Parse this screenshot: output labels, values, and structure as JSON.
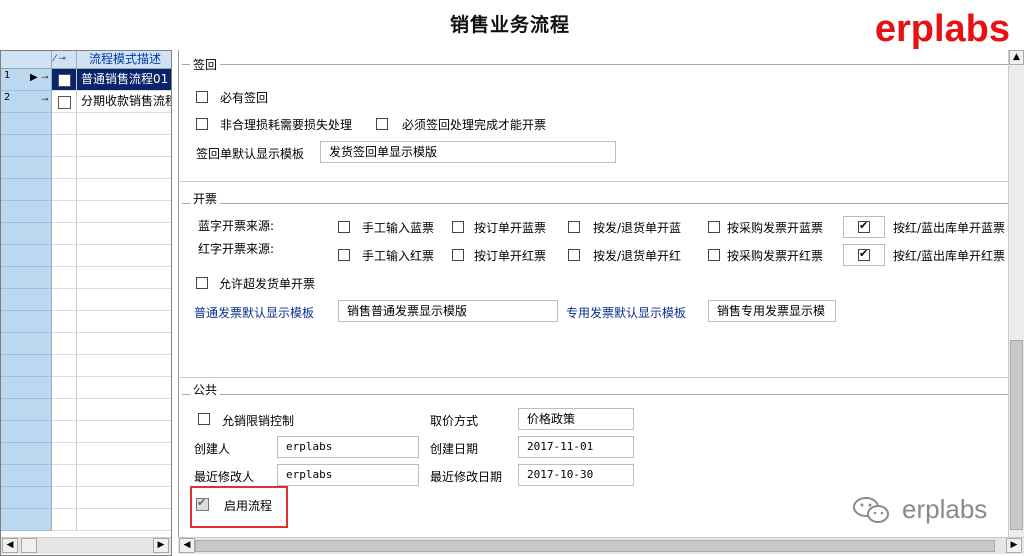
{
  "title": "销售业务流程",
  "brand": "erplabs",
  "watermark": "erplabs",
  "grid": {
    "header": {
      "col_flag": "⁄ ⊸",
      "col_desc": "流程模式描述"
    },
    "rows": [
      {
        "num": "1",
        "desc": "普通销售流程01",
        "selected": true
      },
      {
        "num": "2",
        "desc": "分期收款销售流程",
        "selected": false
      }
    ]
  },
  "sections": {
    "signback": {
      "label": "签回",
      "must_sign": "必有签回",
      "abnormal_loss": "非合理损耗需要损失处理",
      "must_complete": "必须签回处理完成才能开票",
      "template_label": "签回单默认显示模板",
      "template_value": "发货签回单显示模版"
    },
    "invoice": {
      "label": "开票",
      "blue_source_label": "蓝字开票来源:",
      "red_source_label": "红字开票来源:",
      "blue_options": [
        "手工输入蓝票",
        "按订单开蓝票",
        "按发/退货单开蓝",
        "按采购发票开蓝票",
        "按红/蓝出库单开蓝票"
      ],
      "red_options": [
        "手工输入红票",
        "按订单开红票",
        "按发/退货单开红",
        "按采购发票开红票",
        "按红/蓝出库单开红票"
      ],
      "allow_over": "允许超发货单开票",
      "normal_template_label": "普通发票默认显示模板",
      "normal_template_value": "销售普通发票显示模版",
      "special_template_label": "专用发票默认显示模板",
      "special_template_value": "销售专用发票显示模"
    },
    "common": {
      "label": "公共",
      "limit_control": "允销限销控制",
      "price_method_label": "取价方式",
      "price_method_value": "价格政策",
      "creator_label": "创建人",
      "creator_value": "erplabs",
      "created_date_label": "创建日期",
      "created_date_value": "2017-11-01",
      "modifier_label": "最近修改人",
      "modifier_value": "erplabs",
      "modified_date_label": "最近修改日期",
      "modified_date_value": "2017-10-30",
      "enable_flow": "启用流程"
    }
  },
  "colors": {
    "brand": "#e81010",
    "selection": "#0a246a",
    "header_blue": "#cfe3f5",
    "highlight": "#e03030"
  }
}
